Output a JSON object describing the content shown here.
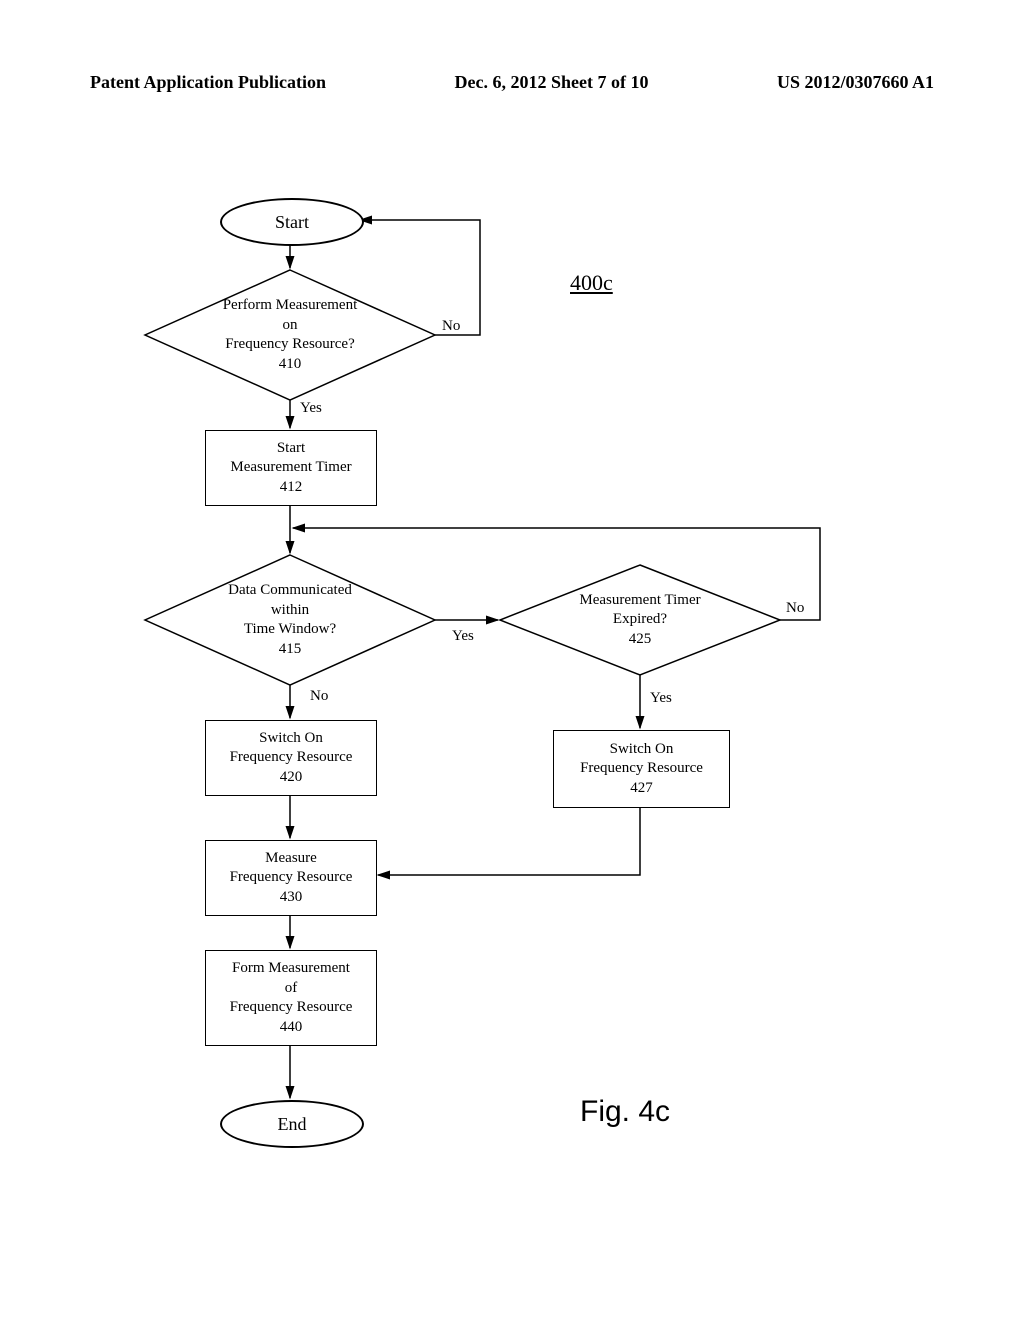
{
  "header": {
    "left": "Patent Application Publication",
    "middle": "Dec. 6, 2012  Sheet 7 of 10",
    "right": "US 2012/0307660 A1"
  },
  "title": "400c",
  "nodes": {
    "start": "Start",
    "d410_l1": "Perform Measurement",
    "d410_l2": "on",
    "d410_l3": "Frequency Resource?",
    "d410_l4": "410",
    "b412_l1": "Start",
    "b412_l2": "Measurement Timer",
    "b412_l3": "412",
    "d415_l1": "Data Communicated",
    "d415_l2": "within",
    "d415_l3": "Time Window?",
    "d415_l4": "415",
    "d425_l1": "Measurement Timer",
    "d425_l2": "Expired?",
    "d425_l3": "425",
    "b420_l1": "Switch On",
    "b420_l2": "Frequency Resource",
    "b420_l3": "420",
    "b427_l1": "Switch On",
    "b427_l2": "Frequency Resource",
    "b427_l3": "427",
    "b430_l1": "Measure",
    "b430_l2": "Frequency Resource",
    "b430_l3": "430",
    "b440_l1": "Form Measurement",
    "b440_l2": "of",
    "b440_l3": "Frequency Resource",
    "b440_l4": "440",
    "end": "End"
  },
  "edges": {
    "no": "No",
    "yes": "Yes"
  },
  "figure": "Fig. 4c"
}
